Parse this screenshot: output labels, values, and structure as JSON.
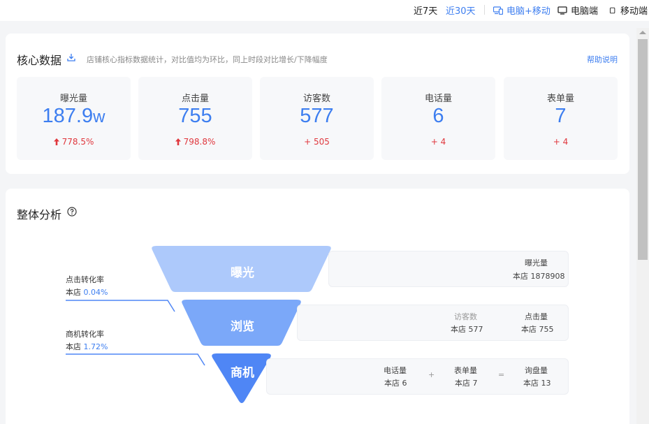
{
  "topbar": {
    "range_7d": "近7天",
    "range_30d": "近30天",
    "device_all": "电脑+移动",
    "device_pc": "电脑端",
    "device_mobile": "移动端"
  },
  "core": {
    "title": "核心数据",
    "desc": "店铺核心指标数据统计，对比值均为环比，同上时段对比增长/下降幅度",
    "help": "帮助说明",
    "metrics": [
      {
        "label": "曝光量",
        "value": "187.9",
        "unit": "w",
        "change": "778.5%"
      },
      {
        "label": "点击量",
        "value": "755",
        "unit": "",
        "change": "798.8%"
      },
      {
        "label": "访客数",
        "value": "577",
        "unit": "",
        "change": "+ 505"
      },
      {
        "label": "电话量",
        "value": "6",
        "unit": "",
        "change": "+ 4"
      },
      {
        "label": "表单量",
        "value": "7",
        "unit": "",
        "change": "+ 4"
      }
    ]
  },
  "analysis": {
    "title": "整体分析",
    "stages": [
      "曝光",
      "浏览",
      "商机"
    ],
    "click_rate": {
      "title": "点击转化率",
      "prefix": "本店 ",
      "value": "0.04%"
    },
    "lead_rate": {
      "title": "商机转化率",
      "prefix": "本店 ",
      "value": "1.72%"
    },
    "row1": {
      "label": "曝光量",
      "value": "本店 1878908"
    },
    "row2": [
      {
        "label": "访客数",
        "value": "本店 577"
      },
      {
        "label": "点击量",
        "value": "本店 755"
      }
    ],
    "row3": [
      {
        "label": "电话量",
        "value": "本店 6"
      },
      {
        "label": "表单量",
        "value": "本店 7"
      },
      {
        "label": "询盘量",
        "value": "本店 13"
      }
    ],
    "op_plus": "+",
    "op_equal": "="
  },
  "colors": {
    "accent": "#3d7ef0",
    "up": "#e0383e",
    "stage1": "#adc9fb",
    "stage2": "#7ba8f9",
    "stage3": "#4f86f5"
  }
}
